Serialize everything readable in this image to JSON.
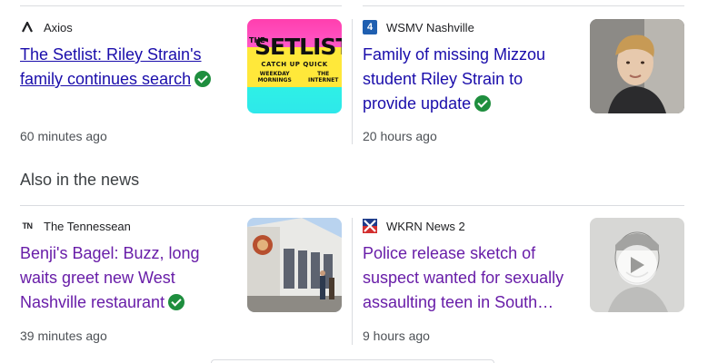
{
  "top_stories": [
    {
      "source": "Axios",
      "source_icon": "axios-logo-icon",
      "headline": "The Setlist: Riley Strain's family continues search",
      "time": "60 minutes ago",
      "verified": true,
      "thumbnail": {
        "kind": "setlist-graphic",
        "line1": "THE",
        "line2": "SETLIST",
        "line3": "CATCH UP QUICK",
        "line4": "WEEKDAY MORNINGS",
        "line5": "THE INTERNET"
      }
    },
    {
      "source": "WSMV Nashville",
      "source_icon": "wsmv-4-logo-icon",
      "source_badge": "4",
      "headline": "Family of missing Mizzou student Riley Strain to provide update",
      "time": "20 hours ago",
      "verified": true,
      "thumbnail": {
        "kind": "portrait-photo"
      }
    }
  ],
  "section_title": "Also in the news",
  "also_news": [
    {
      "source": "The Tennessean",
      "source_icon": "tennessean-tn-logo-icon",
      "source_badge": "TN",
      "headline": "Benji's Bagel: Buzz, long waits greet new West Nashville restaurant",
      "time": "39 minutes ago",
      "verified": true,
      "thumbnail": {
        "kind": "storefront-photo"
      }
    },
    {
      "source": "WKRN News 2",
      "source_icon": "wkrn-news2-logo-icon",
      "headline": "Police release sketch of suspect wanted for sexually assaulting teen in South…",
      "time": "9 hours ago",
      "verified": false,
      "thumbnail": {
        "kind": "sketch-video",
        "has_play": true
      }
    }
  ],
  "colors": {
    "link_unvisited": "#1a0dab",
    "link_visited": "#681da8",
    "verified_green": "#1e8e3e",
    "divider": "#dadce0"
  }
}
